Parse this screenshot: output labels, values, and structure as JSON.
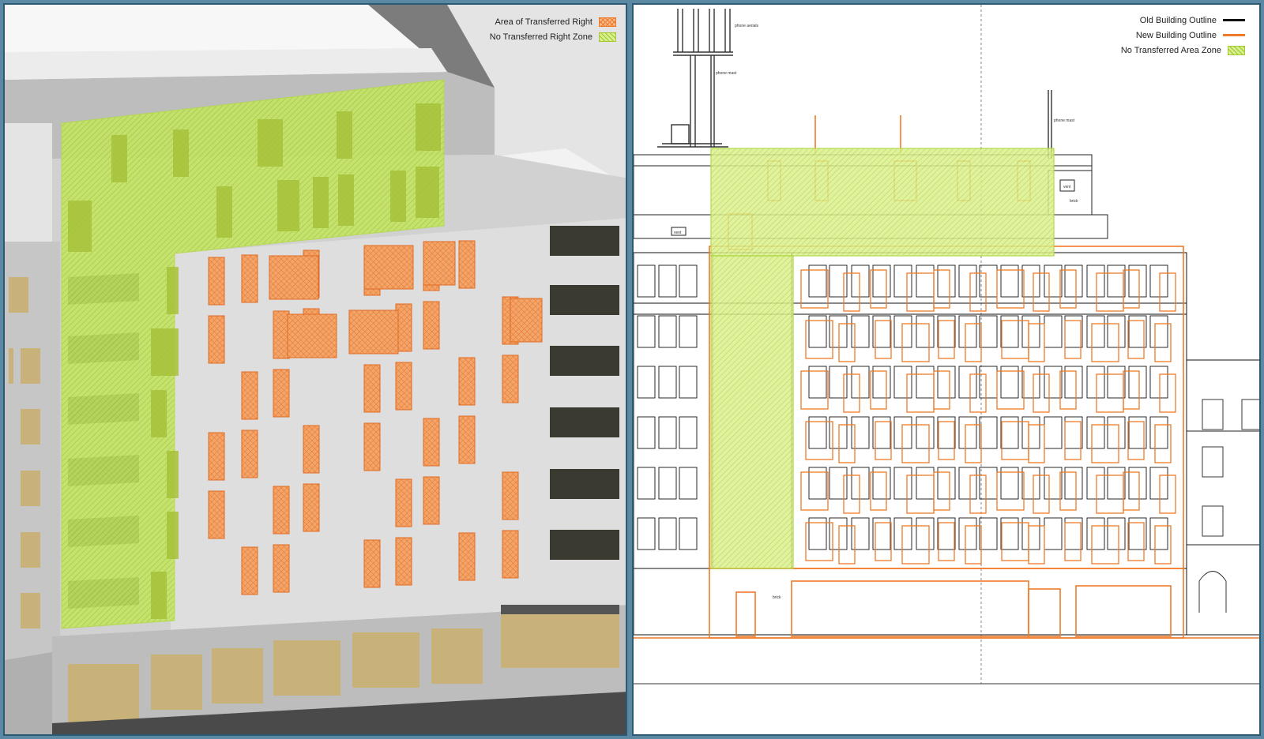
{
  "left_view": {
    "legend": [
      {
        "label": "Area of Transferred Right",
        "swatch": "hatch-orange"
      },
      {
        "label": "No Transferred Right Zone",
        "swatch": "hatch-green"
      }
    ]
  },
  "right_view": {
    "legend": [
      {
        "label": "Old Building Outline",
        "swatch": "line-black"
      },
      {
        "label": "New Building Outline",
        "swatch": "line-orange"
      },
      {
        "label": "No Transferred Area Zone",
        "swatch": "hatch-green"
      }
    ],
    "annotations": {
      "phone_aerials": "phone aerials",
      "phone_mast": "phone mast",
      "phone_mast_right": "phone mast",
      "vent_left": "vent",
      "vent_right": "vent",
      "brick_right": "brick",
      "brick_ground": "brick"
    }
  },
  "colors": {
    "orange": "#ee7b2a",
    "green": "#b4d94a",
    "black": "#111111",
    "frame": "#2b5a72"
  }
}
